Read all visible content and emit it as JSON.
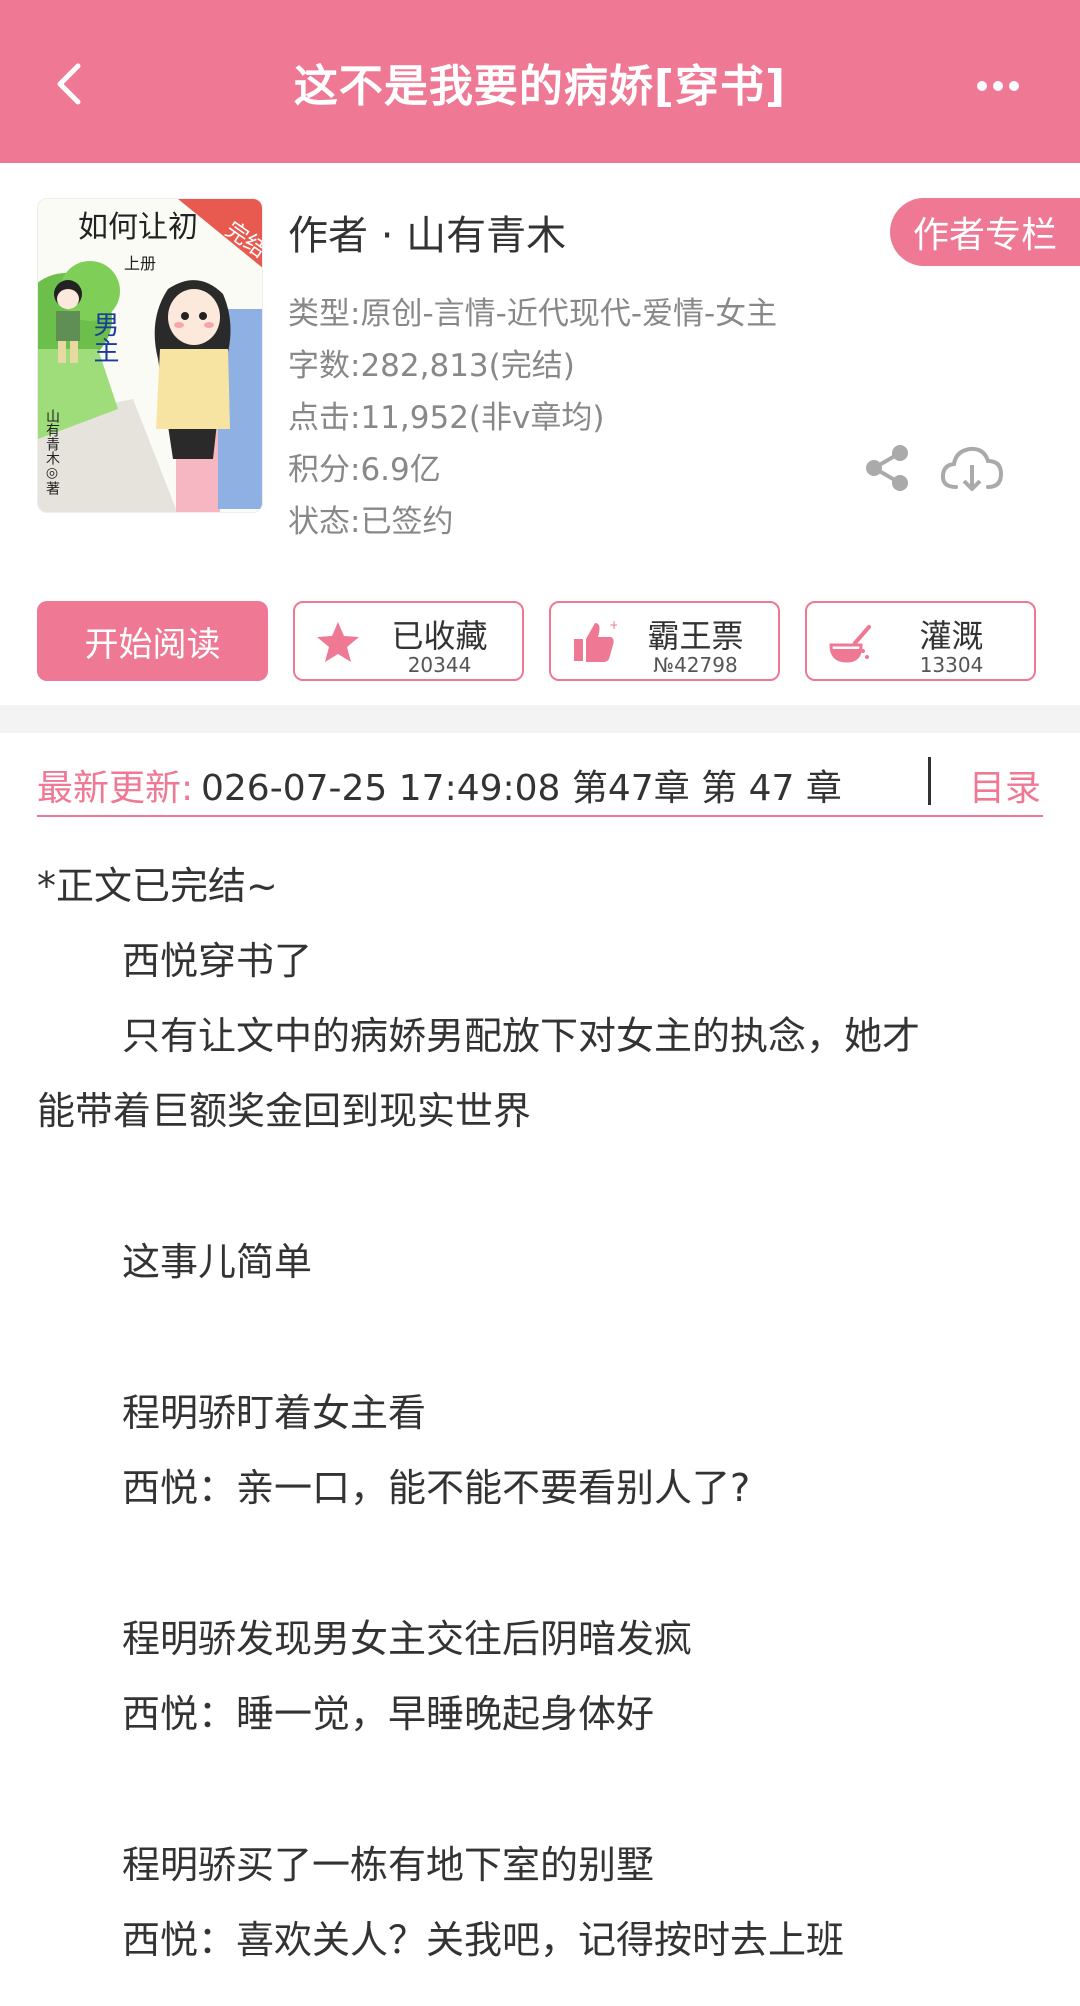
{
  "header": {
    "title": "这不是我要的病娇[穿书]"
  },
  "book": {
    "cover_title": "如何让初",
    "cover_badge": "完结",
    "cover_volume": "上册",
    "cover_male": "男主",
    "cover_author_vertical": "山有青木◎著",
    "author": "作者 · 山有青木",
    "author_column_button": "作者专栏",
    "type": "类型:原创-言情-近代现代-爱情-女主",
    "word_count": "字数:282,813(完结)",
    "clicks": "点击:11,952(非v章均)",
    "points": "积分:6.9亿",
    "status": "状态:已签约"
  },
  "actions": {
    "read": "开始阅读",
    "collect": {
      "label": "已收藏",
      "count": "20344"
    },
    "vote": {
      "label": "霸王票",
      "count": "№42798"
    },
    "water": {
      "label": "灌溉",
      "count": "13304"
    }
  },
  "update": {
    "label": "最新更新:",
    "text": "026-07-25 17:49:08  第47章 第 47 章",
    "toc": "目录"
  },
  "synopsis": [
    "*正文已完结~",
    "西悦穿书了",
    "只有让文中的病娇男配放下对女主的执念，她才",
    "能带着巨额奖金回到现实世界",
    "这事儿简单",
    "程明骄盯着女主看",
    "西悦：亲一口，能不能不要看别人了?",
    "程明骄发现男女主交往后阴暗发疯",
    "西悦：睡一觉，早睡晚起身体好",
    "程明骄买了一栋有地下室的别墅",
    "西悦：喜欢关人？关我吧，记得按时去上班"
  ],
  "colors": {
    "accent": "#ef7894",
    "text": "#333333",
    "meta": "#888888"
  },
  "icons": {
    "back": "chevron-left-icon",
    "more": "more-dots-icon",
    "share": "share-icon",
    "download": "cloud-download-icon",
    "collect": "star-icon",
    "vote": "thumbs-up-icon",
    "water": "watering-can-icon"
  }
}
